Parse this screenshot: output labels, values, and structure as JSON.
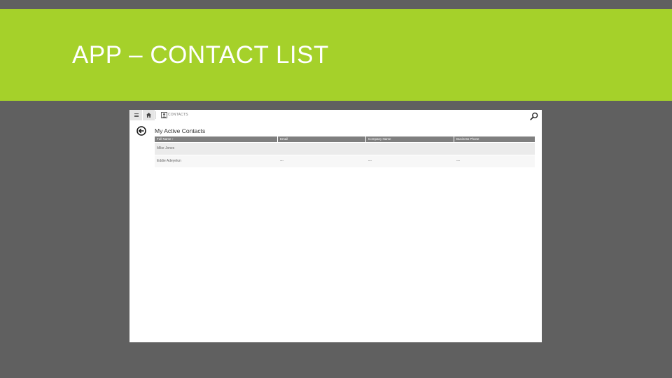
{
  "slide": {
    "title": "APP – CONTACT LIST",
    "band_color": "#a5d12a",
    "background_color": "#606060"
  },
  "app": {
    "topbar": {
      "menu_icon": "hamburger-icon",
      "home_icon": "home-icon",
      "entity_icon": "contacts-icon",
      "entity_label": "CONTACTS",
      "search_icon": "search-icon"
    },
    "view": {
      "back_icon": "back-arrow-icon",
      "title": "My Active Contacts"
    },
    "grid": {
      "columns": [
        "Full Name ↑",
        "Email",
        "Company Name",
        "Business Phone"
      ],
      "rows": [
        [
          "Mike Jones",
          "",
          "",
          ""
        ],
        [
          "Eddie Adeyelun",
          "---",
          "---",
          "---"
        ]
      ],
      "header_color": "#7f7f7f"
    }
  }
}
